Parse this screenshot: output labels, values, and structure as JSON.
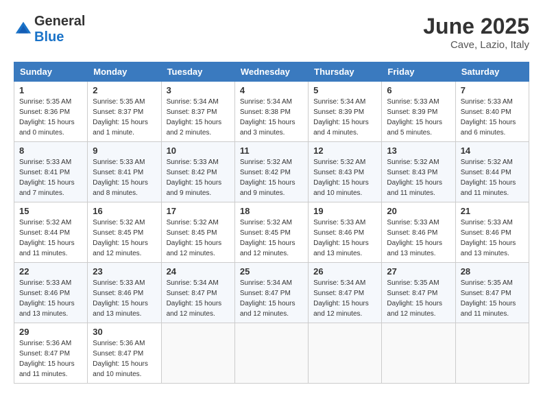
{
  "header": {
    "logo_general": "General",
    "logo_blue": "Blue",
    "month": "June 2025",
    "location": "Cave, Lazio, Italy"
  },
  "weekdays": [
    "Sunday",
    "Monday",
    "Tuesday",
    "Wednesday",
    "Thursday",
    "Friday",
    "Saturday"
  ],
  "weeks": [
    [
      {
        "day": "1",
        "sunrise": "Sunrise: 5:35 AM",
        "sunset": "Sunset: 8:36 PM",
        "daylight": "Daylight: 15 hours and 0 minutes."
      },
      {
        "day": "2",
        "sunrise": "Sunrise: 5:35 AM",
        "sunset": "Sunset: 8:37 PM",
        "daylight": "Daylight: 15 hours and 1 minute."
      },
      {
        "day": "3",
        "sunrise": "Sunrise: 5:34 AM",
        "sunset": "Sunset: 8:37 PM",
        "daylight": "Daylight: 15 hours and 2 minutes."
      },
      {
        "day": "4",
        "sunrise": "Sunrise: 5:34 AM",
        "sunset": "Sunset: 8:38 PM",
        "daylight": "Daylight: 15 hours and 3 minutes."
      },
      {
        "day": "5",
        "sunrise": "Sunrise: 5:34 AM",
        "sunset": "Sunset: 8:39 PM",
        "daylight": "Daylight: 15 hours and 4 minutes."
      },
      {
        "day": "6",
        "sunrise": "Sunrise: 5:33 AM",
        "sunset": "Sunset: 8:39 PM",
        "daylight": "Daylight: 15 hours and 5 minutes."
      },
      {
        "day": "7",
        "sunrise": "Sunrise: 5:33 AM",
        "sunset": "Sunset: 8:40 PM",
        "daylight": "Daylight: 15 hours and 6 minutes."
      }
    ],
    [
      {
        "day": "8",
        "sunrise": "Sunrise: 5:33 AM",
        "sunset": "Sunset: 8:41 PM",
        "daylight": "Daylight: 15 hours and 7 minutes."
      },
      {
        "day": "9",
        "sunrise": "Sunrise: 5:33 AM",
        "sunset": "Sunset: 8:41 PM",
        "daylight": "Daylight: 15 hours and 8 minutes."
      },
      {
        "day": "10",
        "sunrise": "Sunrise: 5:33 AM",
        "sunset": "Sunset: 8:42 PM",
        "daylight": "Daylight: 15 hours and 9 minutes."
      },
      {
        "day": "11",
        "sunrise": "Sunrise: 5:32 AM",
        "sunset": "Sunset: 8:42 PM",
        "daylight": "Daylight: 15 hours and 9 minutes."
      },
      {
        "day": "12",
        "sunrise": "Sunrise: 5:32 AM",
        "sunset": "Sunset: 8:43 PM",
        "daylight": "Daylight: 15 hours and 10 minutes."
      },
      {
        "day": "13",
        "sunrise": "Sunrise: 5:32 AM",
        "sunset": "Sunset: 8:43 PM",
        "daylight": "Daylight: 15 hours and 11 minutes."
      },
      {
        "day": "14",
        "sunrise": "Sunrise: 5:32 AM",
        "sunset": "Sunset: 8:44 PM",
        "daylight": "Daylight: 15 hours and 11 minutes."
      }
    ],
    [
      {
        "day": "15",
        "sunrise": "Sunrise: 5:32 AM",
        "sunset": "Sunset: 8:44 PM",
        "daylight": "Daylight: 15 hours and 11 minutes."
      },
      {
        "day": "16",
        "sunrise": "Sunrise: 5:32 AM",
        "sunset": "Sunset: 8:45 PM",
        "daylight": "Daylight: 15 hours and 12 minutes."
      },
      {
        "day": "17",
        "sunrise": "Sunrise: 5:32 AM",
        "sunset": "Sunset: 8:45 PM",
        "daylight": "Daylight: 15 hours and 12 minutes."
      },
      {
        "day": "18",
        "sunrise": "Sunrise: 5:32 AM",
        "sunset": "Sunset: 8:45 PM",
        "daylight": "Daylight: 15 hours and 12 minutes."
      },
      {
        "day": "19",
        "sunrise": "Sunrise: 5:33 AM",
        "sunset": "Sunset: 8:46 PM",
        "daylight": "Daylight: 15 hours and 13 minutes."
      },
      {
        "day": "20",
        "sunrise": "Sunrise: 5:33 AM",
        "sunset": "Sunset: 8:46 PM",
        "daylight": "Daylight: 15 hours and 13 minutes."
      },
      {
        "day": "21",
        "sunrise": "Sunrise: 5:33 AM",
        "sunset": "Sunset: 8:46 PM",
        "daylight": "Daylight: 15 hours and 13 minutes."
      }
    ],
    [
      {
        "day": "22",
        "sunrise": "Sunrise: 5:33 AM",
        "sunset": "Sunset: 8:46 PM",
        "daylight": "Daylight: 15 hours and 13 minutes."
      },
      {
        "day": "23",
        "sunrise": "Sunrise: 5:33 AM",
        "sunset": "Sunset: 8:46 PM",
        "daylight": "Daylight: 15 hours and 13 minutes."
      },
      {
        "day": "24",
        "sunrise": "Sunrise: 5:34 AM",
        "sunset": "Sunset: 8:47 PM",
        "daylight": "Daylight: 15 hours and 12 minutes."
      },
      {
        "day": "25",
        "sunrise": "Sunrise: 5:34 AM",
        "sunset": "Sunset: 8:47 PM",
        "daylight": "Daylight: 15 hours and 12 minutes."
      },
      {
        "day": "26",
        "sunrise": "Sunrise: 5:34 AM",
        "sunset": "Sunset: 8:47 PM",
        "daylight": "Daylight: 15 hours and 12 minutes."
      },
      {
        "day": "27",
        "sunrise": "Sunrise: 5:35 AM",
        "sunset": "Sunset: 8:47 PM",
        "daylight": "Daylight: 15 hours and 12 minutes."
      },
      {
        "day": "28",
        "sunrise": "Sunrise: 5:35 AM",
        "sunset": "Sunset: 8:47 PM",
        "daylight": "Daylight: 15 hours and 11 minutes."
      }
    ],
    [
      {
        "day": "29",
        "sunrise": "Sunrise: 5:36 AM",
        "sunset": "Sunset: 8:47 PM",
        "daylight": "Daylight: 15 hours and 11 minutes."
      },
      {
        "day": "30",
        "sunrise": "Sunrise: 5:36 AM",
        "sunset": "Sunset: 8:47 PM",
        "daylight": "Daylight: 15 hours and 10 minutes."
      },
      null,
      null,
      null,
      null,
      null
    ]
  ]
}
